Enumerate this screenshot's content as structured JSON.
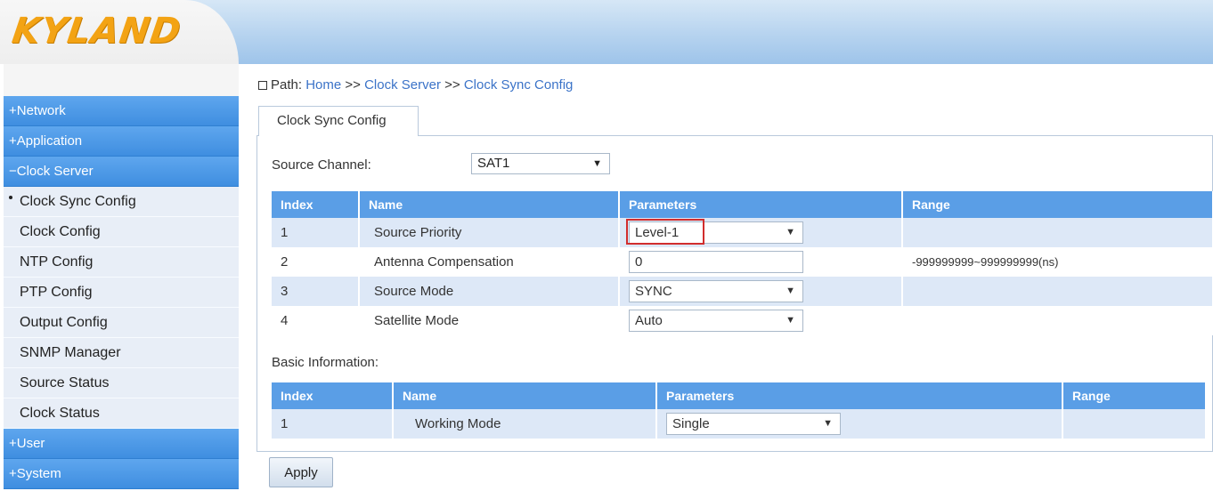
{
  "brand": {
    "logo_text": "KYLAND",
    "colors": {
      "logo": "#f3a314",
      "accent": "#4a95e4",
      "highlight": "#d12d2d"
    }
  },
  "sidebar": {
    "network": "+Network",
    "application": "+Application",
    "clock_server": "−Clock Server",
    "items": [
      {
        "label": "Clock Sync Config"
      },
      {
        "label": "Clock Config"
      },
      {
        "label": "NTP Config"
      },
      {
        "label": "PTP Config"
      },
      {
        "label": "Output Config"
      },
      {
        "label": "SNMP Manager"
      },
      {
        "label": "Source Status"
      },
      {
        "label": "Clock Status"
      }
    ],
    "user": "+User",
    "system": "+System"
  },
  "path": {
    "prefix": "Path:",
    "home": "Home",
    "sep": ">>",
    "clock_server": "Clock Server",
    "current": "Clock Sync Config"
  },
  "tab": {
    "label": "Clock Sync Config"
  },
  "source_channel": {
    "label": "Source Channel:",
    "value": "SAT1"
  },
  "config_table": {
    "headers": {
      "index": "Index",
      "name": "Name",
      "parameters": "Parameters",
      "range": "Range"
    },
    "rows": [
      {
        "index": "1",
        "name": "Source Priority",
        "value": "Level-1",
        "range": ""
      },
      {
        "index": "2",
        "name": "Antenna Compensation",
        "value": "0",
        "range": "-999999999~999999999(ns)"
      },
      {
        "index": "3",
        "name": "Source Mode",
        "value": "SYNC",
        "range": ""
      },
      {
        "index": "4",
        "name": "Satellite Mode",
        "value": "Auto",
        "range": ""
      }
    ]
  },
  "basic_info": {
    "label": "Basic Information:",
    "headers": {
      "index": "Index",
      "name": "Name",
      "parameters": "Parameters",
      "range": "Range"
    },
    "rows": [
      {
        "index": "1",
        "name": "Working Mode",
        "value": "Single",
        "range": ""
      }
    ]
  },
  "apply_label": "Apply"
}
